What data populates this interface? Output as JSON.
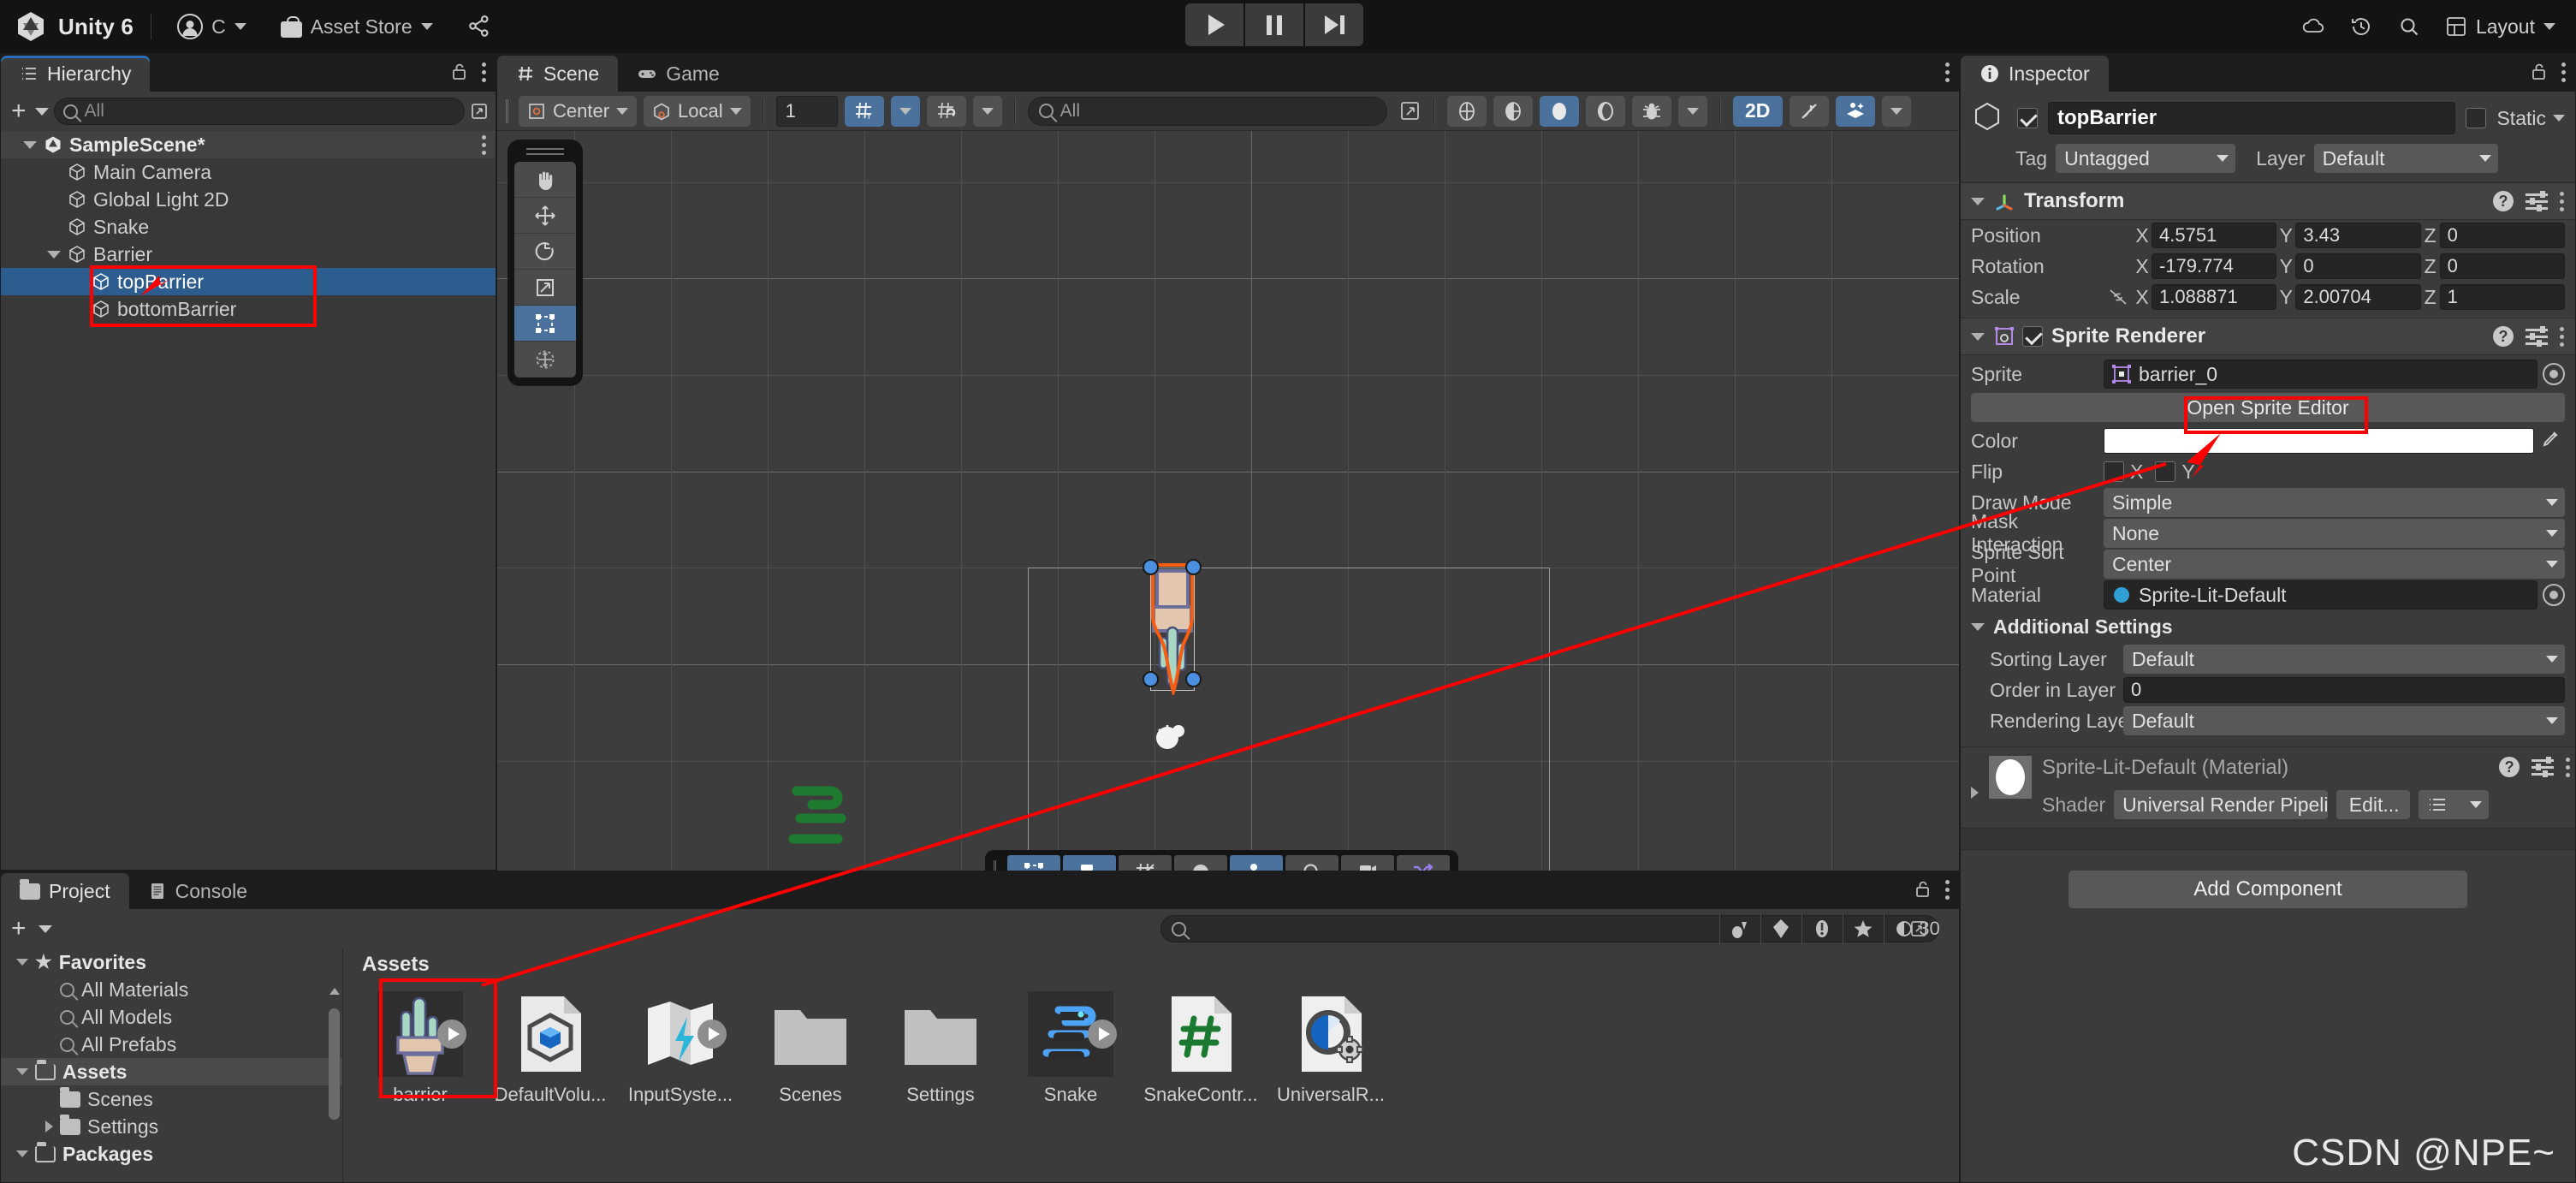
{
  "topbar": {
    "brand": "Unity 6",
    "account_label": "C",
    "asset_store_label": "Asset Store",
    "collab_icon": "share-nodes-icon",
    "cloud_icon": "cloud-icon",
    "history_icon": "history-icon",
    "search_icon": "search-icon",
    "layout_label": "Layout",
    "play_icon": "play-icon",
    "pause_icon": "pause-icon",
    "step_icon": "step-forward-icon"
  },
  "hierarchy": {
    "tab_label": "Hierarchy",
    "search_placeholder": "All",
    "add_label": "+",
    "items": [
      {
        "label": "SampleScene*",
        "depth": 0,
        "expanded": true,
        "selected": false,
        "kind": "scene"
      },
      {
        "label": "Main Camera",
        "depth": 1,
        "expanded": false,
        "selected": false,
        "kind": "go"
      },
      {
        "label": "Global Light 2D",
        "depth": 1,
        "expanded": false,
        "selected": false,
        "kind": "go"
      },
      {
        "label": "Snake",
        "depth": 1,
        "expanded": false,
        "selected": false,
        "kind": "go"
      },
      {
        "label": "Barrier",
        "depth": 1,
        "expanded": true,
        "selected": false,
        "kind": "go"
      },
      {
        "label": "topBarrier",
        "depth": 2,
        "expanded": false,
        "selected": true,
        "kind": "go"
      },
      {
        "label": "bottomBarrier",
        "depth": 2,
        "expanded": false,
        "selected": false,
        "kind": "go"
      }
    ]
  },
  "scene": {
    "tabs": [
      {
        "label": "Scene",
        "icon": "grid-icon",
        "active": true
      },
      {
        "label": "Game",
        "icon": "gamepad-icon",
        "active": false
      }
    ],
    "pivot_label": "Center",
    "handle_label": "Local",
    "grid_size_value": "1",
    "search_placeholder": "All",
    "toggle_2d_label": "2D",
    "tools": [
      {
        "name": "hand-tool",
        "selected": false
      },
      {
        "name": "move-tool",
        "selected": false
      },
      {
        "name": "rotate-tool",
        "selected": false
      },
      {
        "name": "scale-tool",
        "selected": false
      },
      {
        "name": "rect-tool",
        "selected": true
      },
      {
        "name": "transform-tool",
        "selected": false
      }
    ],
    "bottom_tools": [
      {
        "name": "rect-overlay",
        "selected": true
      },
      {
        "name": "settings-overlay",
        "selected": true
      },
      {
        "name": "grid-hidden-overlay",
        "selected": false
      },
      {
        "name": "light-overlay",
        "selected": false
      },
      {
        "name": "layers-overlay",
        "selected": true
      },
      {
        "name": "zoom-overlay",
        "selected": false
      },
      {
        "name": "camera-overlay",
        "selected": false
      },
      {
        "name": "shuffle-overlay",
        "selected": false
      }
    ],
    "render_toggles": [
      {
        "name": "audio-icon",
        "selected": false
      },
      {
        "name": "fx-icon",
        "selected": false
      },
      {
        "name": "lighting-icon",
        "selected": true
      },
      {
        "name": "shadow-icon",
        "selected": false
      },
      {
        "name": "debug-icon",
        "selected": false
      },
      {
        "name": "gizmos-icon",
        "selected": true
      }
    ]
  },
  "inspector": {
    "tab_label": "Inspector",
    "object_name": "topBarrier",
    "enabled": true,
    "static_label": "Static",
    "tag_label": "Tag",
    "tag_value": "Untagged",
    "layer_label": "Layer",
    "layer_value": "Default",
    "transform": {
      "title": "Transform",
      "rows": [
        {
          "label": "Position",
          "x": "4.5751",
          "y": "3.43",
          "z": "0"
        },
        {
          "label": "Rotation",
          "x": "-179.774",
          "y": "0",
          "z": "0"
        },
        {
          "label": "Scale",
          "x": "1.088871",
          "y": "2.00704",
          "z": "1"
        }
      ],
      "axis_labels": [
        "X",
        "Y",
        "Z"
      ],
      "scale_lock_icon": "link-off-icon"
    },
    "sprite_renderer": {
      "title": "Sprite Renderer",
      "enabled": true,
      "sprite_label": "Sprite",
      "sprite_value": "barrier_0",
      "open_sprite_editor_label": "Open Sprite Editor",
      "color_label": "Color",
      "color_value": "#FFFFFF",
      "flip_label": "Flip",
      "flip_x_label": "X",
      "flip_y_label": "Y",
      "draw_mode_label": "Draw Mode",
      "draw_mode_value": "Simple",
      "mask_interaction_label": "Mask Interaction",
      "mask_interaction_value": "None",
      "sprite_sort_point_label": "Sprite Sort Point",
      "sprite_sort_point_value": "Center",
      "material_label": "Material",
      "material_value": "Sprite-Lit-Default",
      "additional_settings_label": "Additional Settings",
      "sorting_layer_label": "Sorting Layer",
      "sorting_layer_value": "Default",
      "order_in_layer_label": "Order in Layer",
      "order_in_layer_value": "0",
      "rendering_layer_label": "Rendering Layer M",
      "rendering_layer_value": "Default"
    },
    "material_block": {
      "title": "Sprite-Lit-Default (Material)",
      "shader_label": "Shader",
      "shader_value": "Universal Render Pipeli",
      "edit_label": "Edit..."
    },
    "add_component_label": "Add Component"
  },
  "project": {
    "tabs": [
      {
        "label": "Project",
        "icon": "folder-icon",
        "active": true
      },
      {
        "label": "Console",
        "icon": "console-icon",
        "active": false
      }
    ],
    "search_placeholder": "",
    "visible_count": "30",
    "tree": [
      {
        "label": "Favorites",
        "kind": "favorites",
        "depth": 0,
        "expanded": true,
        "bold": true
      },
      {
        "label": "All Materials",
        "kind": "search",
        "depth": 1,
        "bold": false
      },
      {
        "label": "All Models",
        "kind": "search",
        "depth": 1,
        "bold": false
      },
      {
        "label": "All Prefabs",
        "kind": "search",
        "depth": 1,
        "bold": false
      },
      {
        "label": "Assets",
        "kind": "folder-open",
        "depth": 0,
        "expanded": true,
        "bold": true,
        "highlight": true
      },
      {
        "label": "Scenes",
        "kind": "folder",
        "depth": 1,
        "bold": false
      },
      {
        "label": "Settings",
        "kind": "folder",
        "depth": 1,
        "bold": false,
        "collapsed": true
      },
      {
        "label": "Packages",
        "kind": "folder-open",
        "depth": 0,
        "expanded": true,
        "bold": true
      }
    ],
    "breadcrumb": "Assets",
    "assets": [
      {
        "label": "barrier",
        "icon": "cactus-sprite",
        "has_play": true,
        "selected": true
      },
      {
        "label": "DefaultVolu...",
        "icon": "volume-profile-icon",
        "has_play": false,
        "selected": false
      },
      {
        "label": "InputSyste...",
        "icon": "input-actions-icon",
        "has_play": true,
        "selected": false
      },
      {
        "label": "Scenes",
        "icon": "folder-icon",
        "has_play": false,
        "selected": false
      },
      {
        "label": "Settings",
        "icon": "folder-icon",
        "has_play": false,
        "selected": false
      },
      {
        "label": "Snake",
        "icon": "snake-sprite",
        "has_play": true,
        "selected": false
      },
      {
        "label": "SnakeContr...",
        "icon": "csharp-script-icon",
        "has_play": false,
        "selected": false
      },
      {
        "label": "UniversalR...",
        "icon": "render-pipeline-asset-icon",
        "has_play": false,
        "selected": false
      }
    ]
  },
  "watermark": "CSDN @NPE~",
  "annotations": {
    "accent_color": "#ff0000",
    "selection_color": "#2d5d8f"
  }
}
